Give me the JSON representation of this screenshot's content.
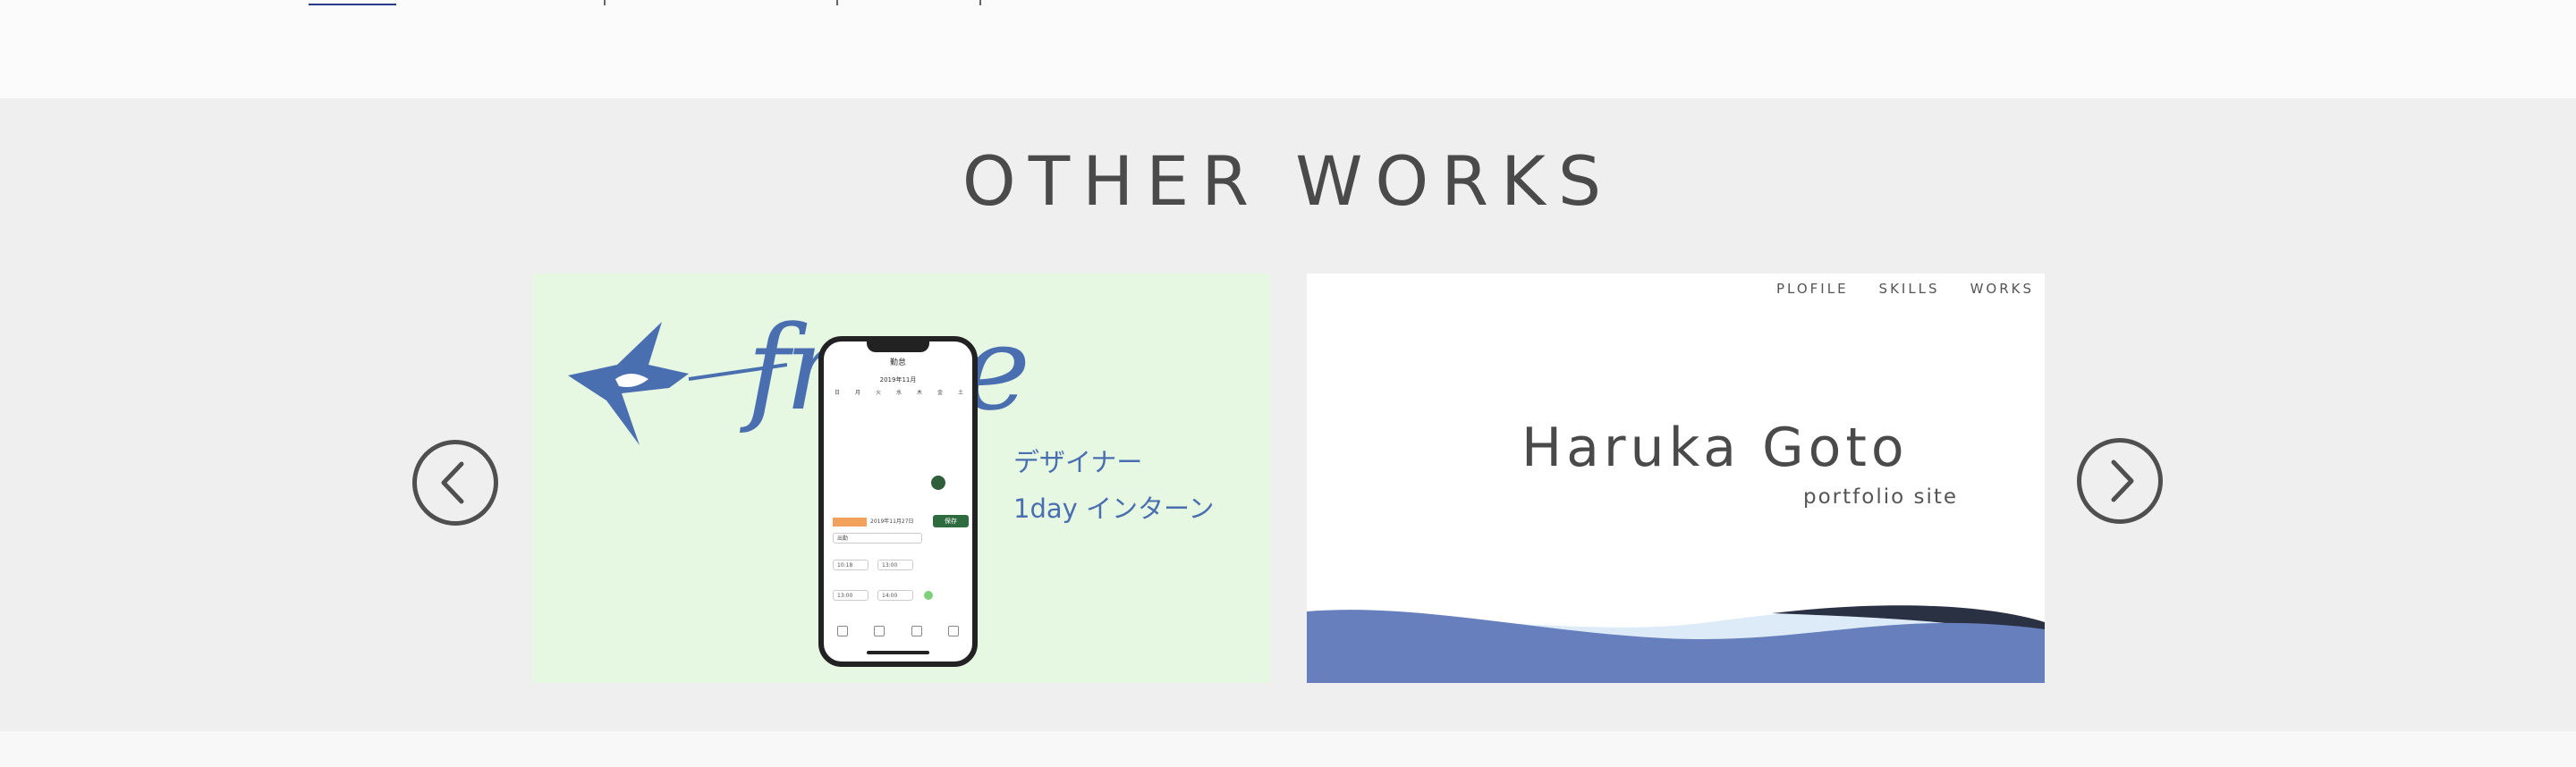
{
  "section": {
    "title": "OTHER WORKS"
  },
  "carousel": {
    "prev_icon": "chevron-left-icon",
    "next_icon": "chevron-right-icon",
    "cards": [
      {
        "brand": "freee",
        "promo_line1": "デザイナー",
        "promo_line2": "1day インターン",
        "phone": {
          "title": "勤怠",
          "month": "2019年11月",
          "weekdays": [
            "日",
            "月",
            "火",
            "水",
            "木",
            "金",
            "土"
          ],
          "form_date": "2019年11月27日",
          "save_label": "保存",
          "work_type": "出勤",
          "start_time": "10:18",
          "end_time": "13:00",
          "break_start": "13:00",
          "break_end": "14:00"
        }
      },
      {
        "nav": [
          "PLOFILE",
          "SKILLS",
          "WORKS"
        ],
        "name": "Haruka Goto",
        "subtitle": "portfolio site"
      }
    ]
  },
  "colors": {
    "section_bg": "#efefef",
    "accent_blue": "#4a6fb0",
    "card1_bg": "#e6f7e2",
    "wave_blue": "#6780bd"
  }
}
